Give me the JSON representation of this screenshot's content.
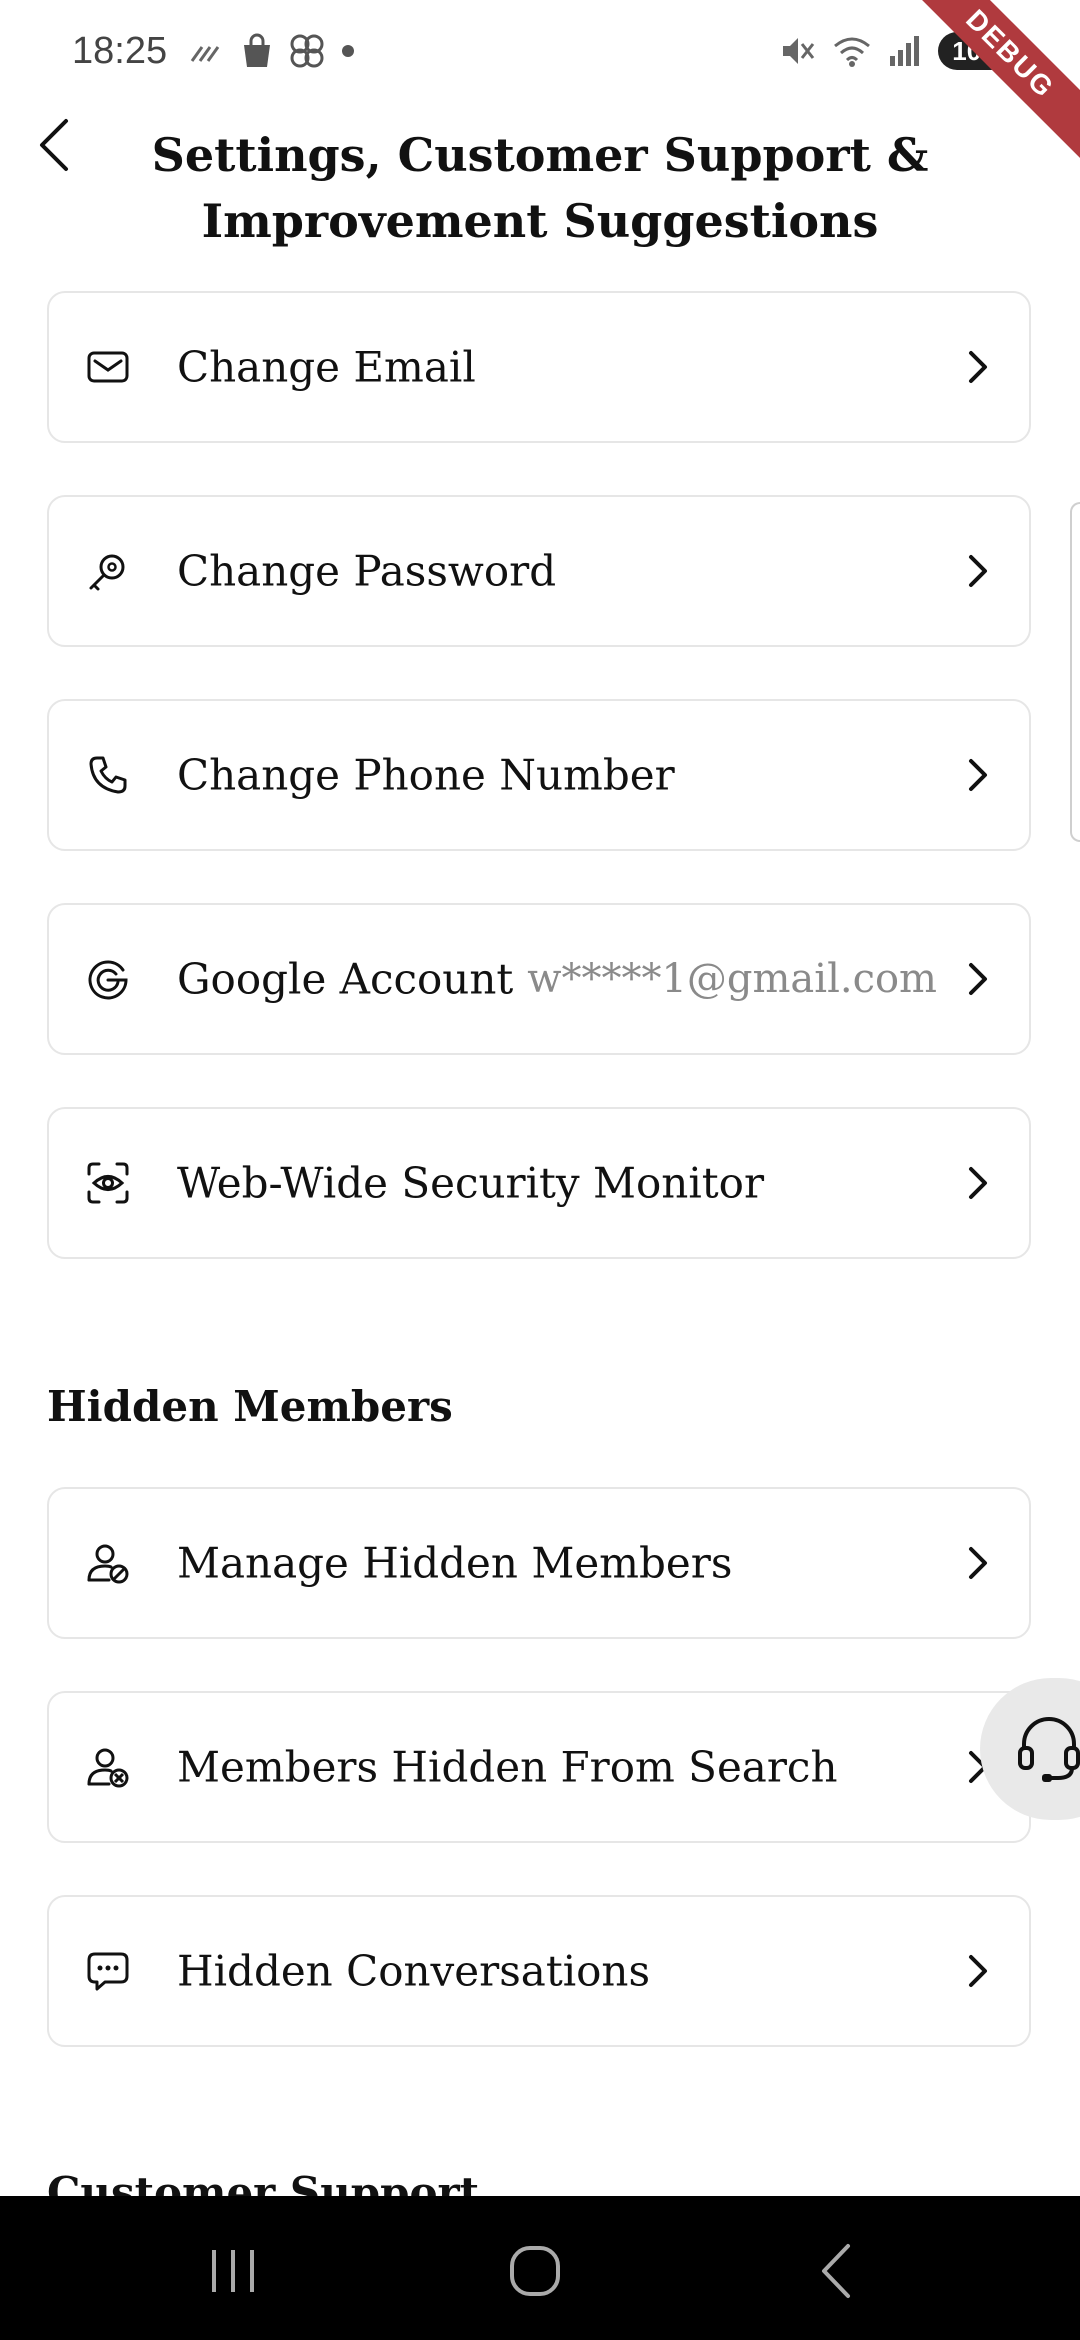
{
  "status_bar": {
    "time": "18:25",
    "battery": "100",
    "debug_label": "DEBUG"
  },
  "header": {
    "title": "Settings, Customer Support & Improvement Suggestions"
  },
  "account_items": [
    {
      "label": "Change Email",
      "icon": "mail-icon"
    },
    {
      "label": "Change Password",
      "icon": "key-icon"
    },
    {
      "label": "Change Phone Number",
      "icon": "phone-icon"
    },
    {
      "label": "Google Account",
      "value": "w*****1@gmail.com",
      "icon": "google-icon"
    },
    {
      "label": "Web-Wide Security Monitor",
      "icon": "eye-scan-icon"
    }
  ],
  "hidden_members": {
    "title": "Hidden Members",
    "items": [
      {
        "label": "Manage Hidden Members",
        "icon": "user-block-icon"
      },
      {
        "label": "Members Hidden From Search",
        "icon": "user-x-icon"
      },
      {
        "label": "Hidden Conversations",
        "icon": "chat-bubble-icon"
      }
    ]
  },
  "customer_support": {
    "title": "Customer Support"
  },
  "colors": {
    "background": "#ffffff",
    "card_border": "#e6e6e6",
    "secondary_text": "#8a8a8a",
    "nav_bar": "#000000",
    "debug_ribbon": "#b03a3e"
  }
}
